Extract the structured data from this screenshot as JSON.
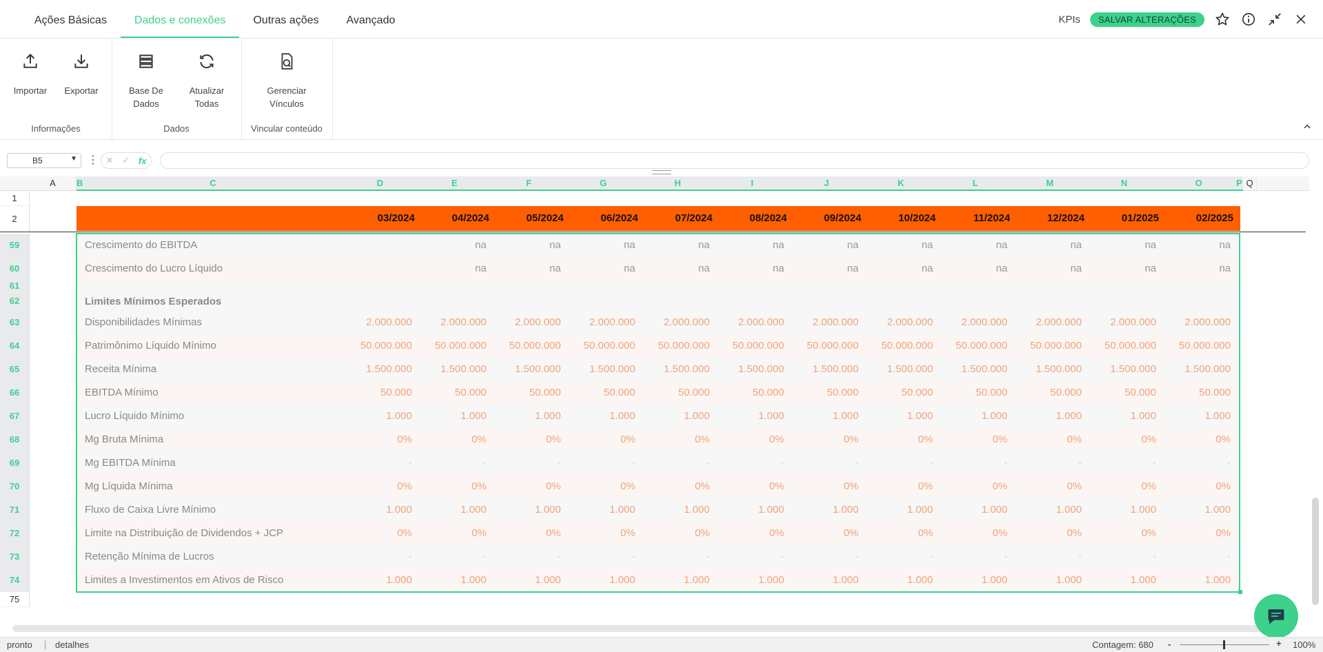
{
  "tabs": [
    "Ações Básicas",
    "Dados e conexões",
    "Outras ações",
    "Avançado"
  ],
  "active_tab": 1,
  "header": {
    "kpis_label": "KPIs",
    "save_label": "SALVAR ALTERAÇÕES"
  },
  "ribbon": {
    "importar": "Importar",
    "exportar": "Exportar",
    "base_l1": "Base De",
    "base_l2": "Dados",
    "atualizar_l1": "Atualizar",
    "atualizar_l2": "Todas",
    "gerenciar_l1": "Gerenciar",
    "gerenciar_l2": "Vínculos",
    "group_info": "Informações",
    "group_dados": "Dados",
    "group_vincular": "Vincular conteúdo"
  },
  "namebox": "B5",
  "columns": [
    "A",
    "B",
    "C",
    "D",
    "E",
    "F",
    "G",
    "H",
    "I",
    "J",
    "K",
    "L",
    "M",
    "N",
    "O",
    "P",
    "Q"
  ],
  "dates": [
    "03/2024",
    "04/2024",
    "05/2024",
    "06/2024",
    "07/2024",
    "08/2024",
    "09/2024",
    "10/2024",
    "11/2024",
    "12/2024",
    "01/2025",
    "02/2025"
  ],
  "row_numbers": [
    "1",
    "2",
    "59",
    "60",
    "61",
    "62",
    "63",
    "64",
    "65",
    "66",
    "67",
    "68",
    "69",
    "70",
    "71",
    "72",
    "73",
    "74",
    "75"
  ],
  "section_title": "Limites Mínimos Esperados",
  "rows": [
    {
      "label": "Crescimento do EBITDA",
      "values": [
        "na",
        "na",
        "na",
        "na",
        "na",
        "na",
        "na",
        "na",
        "na",
        "na",
        "na"
      ]
    },
    {
      "label": "Crescimento do Lucro Líquido",
      "values": [
        "na",
        "na",
        "na",
        "na",
        "na",
        "na",
        "na",
        "na",
        "na",
        "na",
        "na"
      ]
    },
    {
      "label": "Disponibilidades Mínimas",
      "values": [
        "2.000.000",
        "2.000.000",
        "2.000.000",
        "2.000.000",
        "2.000.000",
        "2.000.000",
        "2.000.000",
        "2.000.000",
        "2.000.000",
        "2.000.000",
        "2.000.000",
        "2.000.000"
      ]
    },
    {
      "label": "Patrimônimo Líquido Mínimo",
      "values": [
        "50.000.000",
        "50.000.000",
        "50.000.000",
        "50.000.000",
        "50.000.000",
        "50.000.000",
        "50.000.000",
        "50.000.000",
        "50.000.000",
        "50.000.000",
        "50.000.000",
        "50.000.000"
      ]
    },
    {
      "label": "Receita Mínima",
      "values": [
        "1.500.000",
        "1.500.000",
        "1.500.000",
        "1.500.000",
        "1.500.000",
        "1.500.000",
        "1.500.000",
        "1.500.000",
        "1.500.000",
        "1.500.000",
        "1.500.000",
        "1.500.000"
      ]
    },
    {
      "label": "EBITDA Mínimo",
      "values": [
        "50.000",
        "50.000",
        "50.000",
        "50.000",
        "50.000",
        "50.000",
        "50.000",
        "50.000",
        "50.000",
        "50.000",
        "50.000",
        "50.000"
      ]
    },
    {
      "label": "Lucro Líquido Mínimo",
      "values": [
        "1.000",
        "1.000",
        "1.000",
        "1.000",
        "1.000",
        "1.000",
        "1.000",
        "1.000",
        "1.000",
        "1.000",
        "1.000",
        "1.000"
      ]
    },
    {
      "label": "Mg Bruta Mínima",
      "values": [
        "0%",
        "0%",
        "0%",
        "0%",
        "0%",
        "0%",
        "0%",
        "0%",
        "0%",
        "0%",
        "0%",
        "0%"
      ]
    },
    {
      "label": "Mg EBITDA Mínima",
      "values": [
        "-",
        "-",
        "-",
        "-",
        "-",
        "-",
        "-",
        "-",
        "-",
        "-",
        "-",
        "-"
      ]
    },
    {
      "label": "Mg Líquida Mínima",
      "values": [
        "0%",
        "0%",
        "0%",
        "0%",
        "0%",
        "0%",
        "0%",
        "0%",
        "0%",
        "0%",
        "0%",
        "0%"
      ]
    },
    {
      "label": "Fluxo de Caixa Livre Mínimo",
      "values": [
        "1.000",
        "1.000",
        "1.000",
        "1.000",
        "1.000",
        "1.000",
        "1.000",
        "1.000",
        "1.000",
        "1.000",
        "1.000",
        "1.000"
      ]
    },
    {
      "label": "Limite na Distribuição de Dividendos + JCP",
      "values": [
        "0%",
        "0%",
        "0%",
        "0%",
        "0%",
        "0%",
        "0%",
        "0%",
        "0%",
        "0%",
        "0%",
        "0%"
      ]
    },
    {
      "label": "Retenção Mínima de Lucros",
      "values": [
        "-",
        "-",
        "-",
        "-",
        "-",
        "-",
        "-",
        "-",
        "-",
        "-",
        "-",
        "-"
      ]
    },
    {
      "label": "Limites a Investimentos em Ativos de Risco",
      "values": [
        "1.000",
        "1.000",
        "1.000",
        "1.000",
        "1.000",
        "1.000",
        "1.000",
        "1.000",
        "1.000",
        "1.000",
        "1.000",
        "1.000"
      ]
    }
  ],
  "status": {
    "state": "pronto",
    "details": "detalhes",
    "count": "Contagem: 680",
    "zoom_minus": "-",
    "zoom_plus": "+",
    "zoom": "100%"
  },
  "colors": {
    "accent": "#3dd18b",
    "header_orange": "#ff5f00",
    "number_orange": "#f2a27a"
  }
}
